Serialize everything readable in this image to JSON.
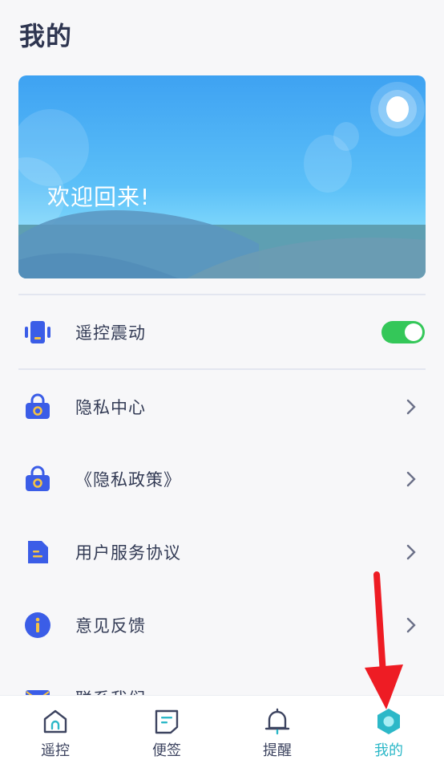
{
  "header": {
    "title": "我的"
  },
  "banner": {
    "text": "欢迎回来!"
  },
  "settings": {
    "vibrate": {
      "label": "遥控震动",
      "enabled": true,
      "icon": "remote-icon"
    }
  },
  "menu": [
    {
      "label": "隐私中心",
      "icon": "lock-icon"
    },
    {
      "label": "《隐私政策》",
      "icon": "lock-icon"
    },
    {
      "label": "用户服务协议",
      "icon": "document-icon"
    },
    {
      "label": "意见反馈",
      "icon": "info-icon"
    },
    {
      "label": "联系我们",
      "icon": "mail-icon"
    }
  ],
  "tabs": [
    {
      "label": "遥控",
      "icon": "home-icon"
    },
    {
      "label": "便签",
      "icon": "note-icon"
    },
    {
      "label": "提醒",
      "icon": "bell-icon"
    },
    {
      "label": "我的",
      "icon": "profile-icon",
      "active": true
    }
  ],
  "colors": {
    "accent": "#2cb8c8",
    "toggle_on": "#34c759",
    "icon_blue": "#3b5de7",
    "annotation_red": "#ee1c24"
  }
}
